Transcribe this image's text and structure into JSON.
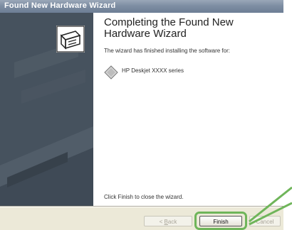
{
  "window": {
    "title": "Found New Hardware Wizard"
  },
  "content": {
    "heading": "Completing the Found New Hardware Wizard",
    "description": "The wizard has finished installing the software for:",
    "device_name": "HP Deskjet XXXX series",
    "close_instruction": "Click Finish to close the wizard."
  },
  "buttons": {
    "back_prefix": "< ",
    "back_key": "B",
    "back_rest": "ack",
    "finish": "Finish",
    "cancel": "Cancel"
  },
  "colors": {
    "highlight": "#6fb55a",
    "sidepanel": "#46525e"
  },
  "icons": [
    "hardware-wizard-icon",
    "device-icon"
  ]
}
